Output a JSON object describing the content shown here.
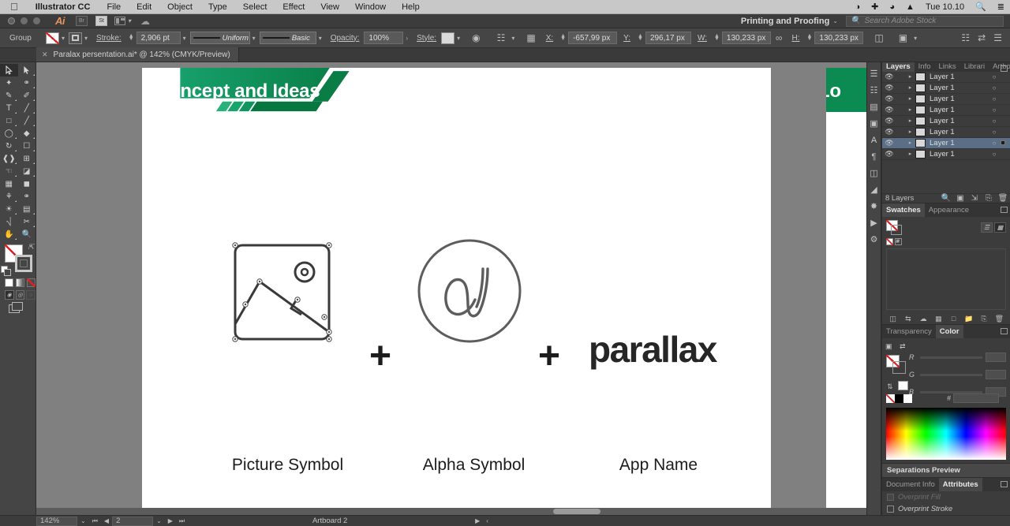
{
  "macbar": {
    "apple_icon": "apple-icon",
    "app_name": "Illustrator CC",
    "menus": [
      "File",
      "Edit",
      "Object",
      "Type",
      "Select",
      "Effect",
      "View",
      "Window",
      "Help"
    ],
    "right_icons": [
      "dropbox-icon",
      "vpn-icon",
      "wifi-icon",
      "eject-icon"
    ],
    "clock": "Tue 10.10",
    "search_icon": "spotlight-search-icon",
    "list_icon": "notification-center-icon"
  },
  "appbar": {
    "logo": "Ai",
    "bridge_label": "Br",
    "stock_label": "St",
    "arrange_label": "arrange-documents-icon",
    "cc_label": "creative-cloud-icon",
    "workspace": "Printing and Proofing",
    "workspace_chevron": "⌄",
    "search_placeholder": "Search Adobe Stock",
    "search_icon": "search-icon"
  },
  "controlbar": {
    "selection_label": "Group",
    "fill_label": "fill-swatch",
    "stroke_swatch_label": "stroke-swatch",
    "stroke_label": "Stroke:",
    "stroke_weight": "2,906 pt",
    "stroke_profile": "Uniform",
    "brush_definition": "Basic",
    "opacity_label": "Opacity:",
    "opacity_value": "100%",
    "style_label": "Style:",
    "x_label": "X:",
    "x_value": "-657,99 px",
    "y_label": "Y:",
    "y_value": "296,17 px",
    "w_label": "W:",
    "w_value": "130,233 px",
    "h_label": "H:",
    "h_value": "130,233 px",
    "link_icon": "constrain-proportions-icon",
    "recolor_icon": "recolor-artwork-icon",
    "align_icon": "align-icon",
    "transform_icon": "transform-icon",
    "distribute_icon": "distribute-spacing-icon",
    "arrange_icon": "arrange-icon",
    "doc_setup_icon": "document-setup-icon",
    "prefs_icon": "preferences-icon"
  },
  "tabbar": {
    "close_icon": "✕",
    "document_title": "Paralax persentation.ai* @ 142% (CMYK/Preview)"
  },
  "toolbar": {
    "tools": [
      [
        "selection-tool",
        "direct-selection-tool"
      ],
      [
        "magic-wand-tool",
        "lasso-tool"
      ],
      [
        "pen-tool",
        "curvature-tool"
      ],
      [
        "type-tool",
        "line-segment-tool"
      ],
      [
        "rectangle-tool",
        "paintbrush-tool"
      ],
      [
        "shaper-tool",
        "shape-builder-tool"
      ],
      [
        "rotate-tool",
        "scale-tool"
      ],
      [
        "width-tool",
        "free-transform-tool"
      ],
      [
        "puppet-warp-tool",
        "gradient-tool"
      ],
      [
        "perspective-grid-tool",
        "mesh-tool"
      ],
      [
        "eyedropper-tool",
        "blend-tool"
      ],
      [
        "symbol-sprayer-tool",
        "column-graph-tool"
      ],
      [
        "artboard-tool",
        "slice-tool"
      ],
      [
        "hand-tool",
        "zoom-tool"
      ]
    ],
    "fill_label": "fill-indicator-none",
    "stroke_label": "stroke-indicator",
    "swap_icon": "swap-fill-stroke-icon",
    "default_icon": "default-fill-stroke-icon",
    "color_modes": [
      "color-mode",
      "gradient-mode",
      "none-mode"
    ],
    "screen_modes": [
      "drawing-mode-normal",
      "drawing-mode-behind",
      "drawing-mode-inside"
    ],
    "screen_mode_icon": "change-screen-mode-icon"
  },
  "artwork": {
    "banner_title": "Concept and Ideas",
    "banner_title_2": "Lo",
    "plus_1": "+",
    "plus_2": "+",
    "wordmark": "parallax",
    "captions": [
      "Picture Symbol",
      "Alpha Symbol",
      "App Name"
    ],
    "colors": {
      "banner_light_green": "#12a06a",
      "banner_dark_green": "#0a7a44",
      "banner_deep_green": "#056b39",
      "text_dark": "#262626"
    }
  },
  "dockrail": {
    "icons": [
      "panel-menu-icon",
      "layers-panel-icon",
      "properties-panel-icon",
      "color-guide-icon",
      "character-panel-icon",
      "paragraph-panel-icon",
      "pathfinder-icon",
      "align-panel-icon",
      "symbols-panel-icon",
      "brushes-panel-icon",
      "libraries-panel-icon"
    ]
  },
  "layers_panel": {
    "tabs": [
      "Layers",
      "Info",
      "Links",
      "Librari",
      "Artboa"
    ],
    "active_tab": "Layers",
    "menu_icon": "panel-options-icon",
    "rows": [
      {
        "name": "Layer 1",
        "visible": true,
        "selected": false,
        "thumb": "image-thumb"
      },
      {
        "name": "Layer 1",
        "visible": true,
        "selected": false,
        "thumb": "image-thumb"
      },
      {
        "name": "Layer 1",
        "visible": true,
        "selected": false,
        "thumb": "chart-thumb"
      },
      {
        "name": "Layer 1",
        "visible": true,
        "selected": false,
        "thumb": "slide-thumb"
      },
      {
        "name": "Layer 1",
        "visible": true,
        "selected": false,
        "thumb": "slide-thumb"
      },
      {
        "name": "Layer 1",
        "visible": true,
        "selected": false,
        "thumb": "slide-thumb"
      },
      {
        "name": "Layer 1",
        "visible": true,
        "selected": true,
        "thumb": "slide-thumb"
      },
      {
        "name": "Layer 1",
        "visible": true,
        "selected": false,
        "thumb": "text-thumb"
      }
    ],
    "count_label": "8 Layers",
    "footer_icons": [
      "locate-object-icon",
      "make-clipping-mask-icon",
      "create-new-sublayer-icon",
      "create-new-layer-icon",
      "delete-selection-icon"
    ]
  },
  "swatches_panel": {
    "tabs": [
      "Swatches",
      "Appearance"
    ],
    "active_tab": "Swatches",
    "menu_icon": "panel-options-icon",
    "list_view_icon": "list-view-icon",
    "grid_view_icon": "grid-view-icon",
    "swatches": [
      "none-swatch",
      "registration-swatch"
    ],
    "footer_icons": [
      "swatch-libraries-icon",
      "show-swatch-kinds-icon",
      "color-themes-icon",
      "color-group-icon",
      "new-color-group-icon",
      "new-swatch-icon",
      "delete-swatch-icon"
    ]
  },
  "color_panel": {
    "tabs": [
      "Transparency",
      "Color"
    ],
    "active_tab": "Color",
    "menu_icon": "panel-options-icon",
    "channels": [
      "R",
      "G",
      "B"
    ],
    "channel_values": [
      "",
      "",
      ""
    ],
    "hex_label": "#",
    "hex_value": ""
  },
  "separations_panel": {
    "title": "Separations Preview"
  },
  "attributes_panel": {
    "tabs": [
      "Document Info",
      "Attributes"
    ],
    "active_tab": "Attributes",
    "menu_icon": "panel-options-icon",
    "overprint_fill": "Overprint Fill",
    "overprint_stroke": "Overprint Stroke",
    "fill_checked": false,
    "stroke_checked": false
  },
  "statusbar": {
    "zoom": "142%",
    "zoom_chevron": "⌄",
    "first_icon": "⏮",
    "prev_icon": "◀",
    "page": "2",
    "page_chevron": "⌄",
    "next_icon": "▶",
    "last_icon": "⏭",
    "artboard_label": "Artboard 2",
    "play_icon": "▶",
    "resize_icon": "‹"
  }
}
